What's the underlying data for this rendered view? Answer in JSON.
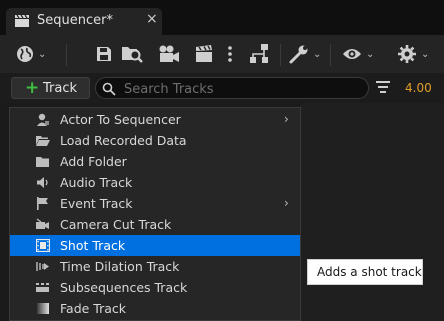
{
  "tab": {
    "title": "Sequencer*",
    "close": "×"
  },
  "toolbar": {
    "icons": [
      "world-icon",
      "save-icon",
      "browse-icon",
      "camera-icon",
      "clapperboard-icon",
      "more-icon",
      "hierarchy-icon",
      "wrench-icon",
      "eye-icon",
      "gear-icon"
    ]
  },
  "filterbar": {
    "track_button": "Track",
    "search_placeholder": "Search Tracks",
    "search_value": "",
    "fps": "4.00"
  },
  "menu": {
    "items": [
      {
        "label": "Actor To Sequencer",
        "icon": "actor-icon",
        "submenu": true,
        "arrow": "›"
      },
      {
        "label": "Load Recorded Data",
        "icon": "folder-open-icon",
        "submenu": false
      },
      {
        "label": "Add Folder",
        "icon": "folder-icon",
        "submenu": false
      },
      {
        "label": "Audio Track",
        "icon": "speaker-icon",
        "submenu": false
      },
      {
        "label": "Event Track",
        "icon": "flag-icon",
        "submenu": true,
        "arrow": "›"
      },
      {
        "label": "Camera Cut Track",
        "icon": "camera-cut-icon",
        "submenu": false
      },
      {
        "label": "Shot Track",
        "icon": "film-icon",
        "submenu": false,
        "selected": true
      },
      {
        "label": "Time Dilation Track",
        "icon": "time-dilation-icon",
        "submenu": false
      },
      {
        "label": "Subsequences Track",
        "icon": "subsequence-icon",
        "submenu": false
      },
      {
        "label": "Fade Track",
        "icon": "fade-icon",
        "submenu": false
      }
    ]
  },
  "tooltip": {
    "text": "Adds a shot track."
  },
  "colors": {
    "accent": "#0070e0",
    "fps": "#e09d2a",
    "plus": "#3fbf3f"
  }
}
